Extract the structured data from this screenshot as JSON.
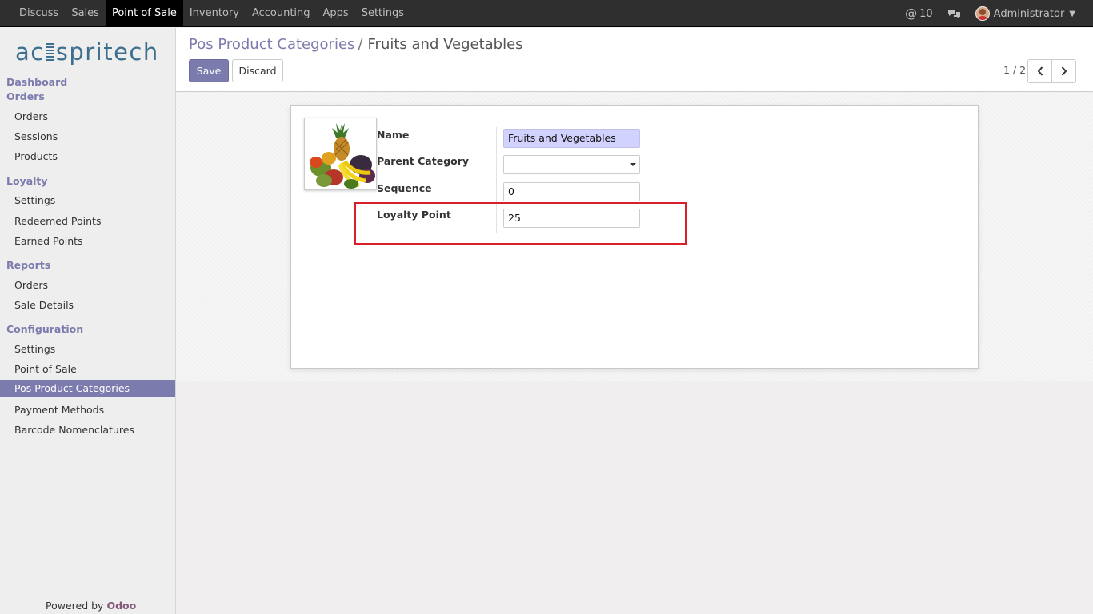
{
  "topnav": {
    "items": [
      "Discuss",
      "Sales",
      "Point of Sale",
      "Inventory",
      "Accounting",
      "Apps",
      "Settings"
    ],
    "active": "Point of Sale",
    "mentions_count": "10",
    "user": "Administrator"
  },
  "sidebar": {
    "logo": {
      "left": "ac",
      "right": "spritech"
    },
    "dashboard": "Dashboard",
    "orders_header": "Orders",
    "orders_items": [
      "Orders",
      "Sessions",
      "Products"
    ],
    "loyalty_header": "Loyalty",
    "loyalty_items": [
      "Settings",
      "Redeemed Points",
      "Earned Points"
    ],
    "reports_header": "Reports",
    "reports_items": [
      "Orders",
      "Sale Details"
    ],
    "config_header": "Configuration",
    "config_items": [
      "Settings",
      "Point of Sale",
      "Pos Product Categories",
      "Payment Methods",
      "Barcode Nomenclatures"
    ],
    "active_item": "Pos Product Categories",
    "powered_by": "Powered by",
    "powered_brand": "Odoo"
  },
  "control": {
    "breadcrumb_parent": "Pos Product Categories",
    "breadcrumb_sep": "/",
    "breadcrumb_current": "Fruits and Vegetables",
    "save_label": "Save",
    "discard_label": "Discard",
    "pager": "1 / 2"
  },
  "form": {
    "name_label": "Name",
    "name_value": "Fruits and Vegetables",
    "parent_label": "Parent Category",
    "parent_value": "",
    "sequence_label": "Sequence",
    "sequence_value": "0",
    "loyalty_label": "Loyalty Point",
    "loyalty_value": "25"
  },
  "colors": {
    "primary": "#7c7bad",
    "topbar": "#2f2f2f",
    "highlight": "#d9202a",
    "required_field": "#d2d2ff"
  }
}
